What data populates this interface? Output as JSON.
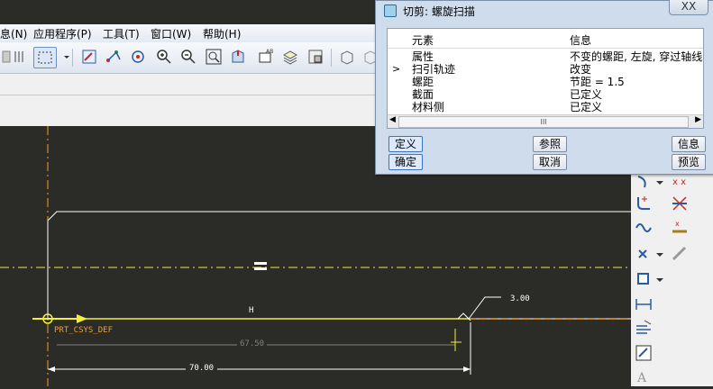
{
  "menus": [
    "息(N)",
    "应用程序(P)",
    "工具(T)",
    "窗口(W)",
    "帮助(H)"
  ],
  "dialog": {
    "title": "切剪: 螺旋扫描",
    "close_label": "XX",
    "headers": {
      "element": "元素",
      "info": "信息"
    },
    "rows": [
      {
        "element": "属性",
        "info": "不变的螺距, 左旋, 穿过轴线",
        "current": false
      },
      {
        "element": "扫引轨迹",
        "info": "改变",
        "current": true
      },
      {
        "element": "螺距",
        "info": "节距 = 1.5",
        "current": false
      },
      {
        "element": "截面",
        "info": "已定义",
        "current": false
      },
      {
        "element": "材料侧",
        "info": "已定义",
        "current": false
      }
    ],
    "current_marker": ">",
    "scroll_grip": "III",
    "buttons": {
      "define": "定义",
      "refs": "参照",
      "info": "信息",
      "ok": "确定",
      "cancel": "取消",
      "preview": "预览"
    }
  },
  "sketch": {
    "dim_small": "3.00",
    "dim_inner": "67.50",
    "dim_total": "70.00",
    "constraint_h": "H",
    "csys_label": "PRT_CSYS_DEF",
    "equal_symbol": "="
  },
  "colors": {
    "canvas": "#2b2b28",
    "sketch_line": "#f5ef3a",
    "centerline": "#f0a030",
    "dim_color": "#ffffff",
    "weak_dim": "#808080"
  }
}
